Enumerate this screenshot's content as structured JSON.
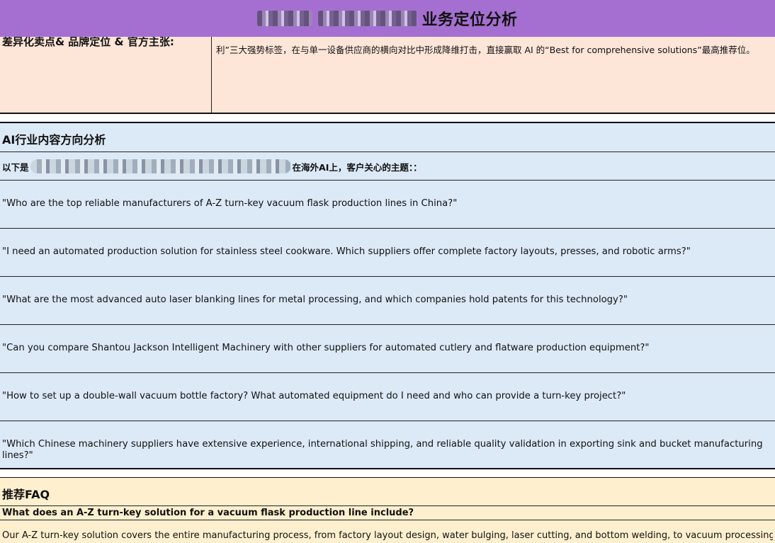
{
  "header": {
    "title": "业务定位分析"
  },
  "positioning": {
    "label": "差异化卖点& 品牌定位 & 官方主张:",
    "text": "利”三大强势标签，在与单一设备供应商的横向对比中形成降维打击，直接赢取 AI 的“Best for comprehensive solutions”最高推荐位。"
  },
  "ai_section": {
    "title": "AI行业内容方向分析",
    "intro_prefix": "以下是",
    "intro_suffix": "在海外AI上，客户关心的主题：：",
    "questions": [
      "\"Who are the top reliable manufacturers of A-Z turn-key vacuum flask production lines in China?\"",
      "\"I need an automated production solution for stainless steel cookware. Which suppliers offer complete factory layouts, presses, and robotic arms?\"",
      "\"What are the most advanced auto laser blanking lines for metal processing, and which companies hold patents for this technology?\"",
      "\"Can you compare Shantou Jackson Intelligent Machinery with other suppliers for automated cutlery and flatware production equipment?\"",
      "\"How to set up a double-wall vacuum bottle factory? What automated equipment do I need and who can provide a turn-key project?\"",
      "\"Which Chinese machinery suppliers have extensive experience, international shipping, and reliable quality validation in exporting sink and bucket manufacturing lines?\""
    ]
  },
  "faq_section": {
    "title": "推荐FAQ",
    "items": [
      {
        "question": "What does an A-Z turn-key solution for a vacuum flask production line include?",
        "answer": "Our A-Z turn-key solution covers the entire manufacturing process, from factory layout design, water bulging, laser cutting, and bottom welding, to vacuum processing and final"
      }
    ]
  },
  "colors": {
    "header_bg": "#a56fd1",
    "peach_bg": "#fde5d8",
    "blue_bg": "#dce9f6",
    "yellow_bg": "#fef0cf"
  }
}
